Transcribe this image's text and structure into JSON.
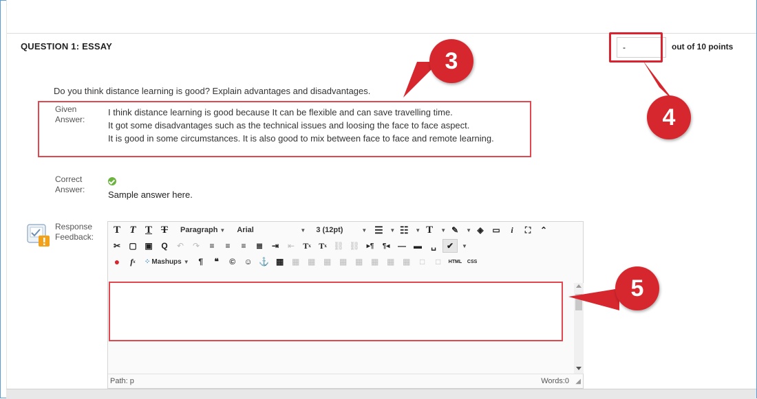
{
  "question": {
    "title": "QUESTION 1:  ESSAY",
    "text": "Do you think distance learning is good? Explain advantages and disadvantages.",
    "score_value": "-",
    "score_suffix": "out of 10 points"
  },
  "given_answer": {
    "label_line1": "Given",
    "label_line2": "Answer:",
    "lines": [
      "I think distance learning is good because It can be flexible and can save travelling time.",
      "It got some disadvantages such as the technical issues and loosing the face to face aspect.",
      "It is good in some circumstances.  It is also good to mix between face to face and remote learning."
    ]
  },
  "correct_answer": {
    "label_line1": "Correct",
    "label_line2": "Answer:",
    "icon": "check-circle-icon",
    "text": "Sample answer here."
  },
  "feedback": {
    "label_line1": "Response",
    "label_line2": "Feedback:",
    "toolbar": {
      "paragraph": "Paragraph",
      "font": "Arial",
      "size": "3 (12pt)",
      "mashups": "Mashups",
      "html": "HTML",
      "css": "CSS"
    },
    "path_label": "Path: p",
    "words_label": "Words:0"
  },
  "callouts": [
    "3",
    "4",
    "5"
  ],
  "colors": {
    "callout_red": "#d7272e",
    "highlight_red": "#e0474f",
    "check_green": "#6cb33f"
  }
}
